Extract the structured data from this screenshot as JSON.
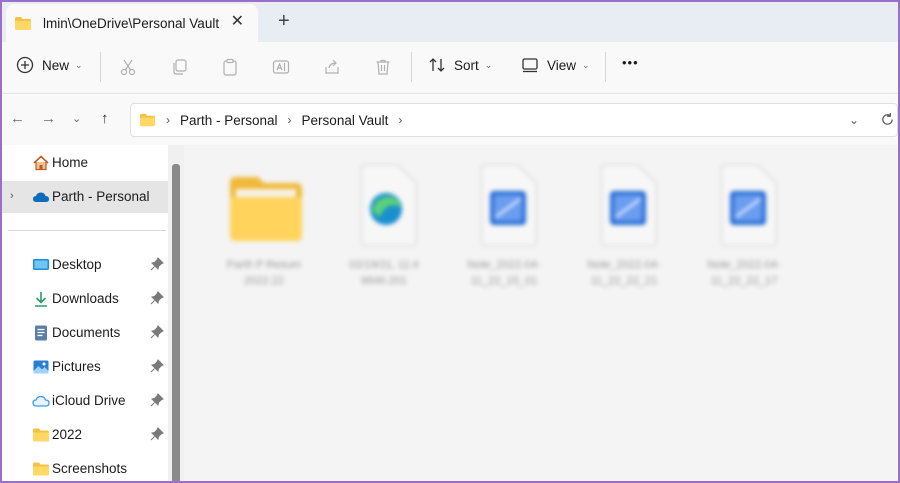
{
  "window": {
    "tab_title": "lmin\\OneDrive\\Personal Vault",
    "tab_close": "✕",
    "new_tab": "+"
  },
  "toolbar": {
    "new_label": "New",
    "sort_label": "Sort",
    "view_label": "View",
    "more_label": "•••"
  },
  "address": {
    "crumbs": [
      "Parth - Personal",
      "Personal Vault"
    ]
  },
  "sidebar": {
    "items": [
      {
        "label": "Home",
        "icon": "home-icon"
      },
      {
        "label": "Parth - Personal",
        "icon": "onedrive-cloud-icon"
      },
      {
        "label": "Desktop",
        "icon": "desktop-icon",
        "pinned": true
      },
      {
        "label": "Downloads",
        "icon": "download-icon",
        "pinned": true
      },
      {
        "label": "Documents",
        "icon": "documents-icon",
        "pinned": true
      },
      {
        "label": "Pictures",
        "icon": "pictures-icon",
        "pinned": true
      },
      {
        "label": "iCloud Drive",
        "icon": "icloud-icon",
        "pinned": true
      },
      {
        "label": "2022",
        "icon": "folder-icon",
        "pinned": true
      },
      {
        "label": "Screenshots",
        "icon": "folder-icon",
        "pinned": false
      }
    ]
  },
  "files": [
    {
      "name_line1": "Parth P Resum",
      "name_line2": "2022.22",
      "type": "folder"
    },
    {
      "name_line1": "02/19/21, 11:4",
      "name_line2": "9846.201",
      "type": "edge-file"
    },
    {
      "name_line1": "Note_2022-04-",
      "name_line2": "11_22_15_01",
      "type": "image-file"
    },
    {
      "name_line1": "Note_2022-04-",
      "name_line2": "11_22_22_21",
      "type": "image-file"
    },
    {
      "name_line1": "Note_2022-04-",
      "name_line2": "11_22_22_17",
      "type": "image-file"
    }
  ],
  "colors": {
    "accent_frame": "#9b6fc9",
    "folder_yellow": "#f7c948",
    "onedrive_blue": "#0f6cbd"
  }
}
